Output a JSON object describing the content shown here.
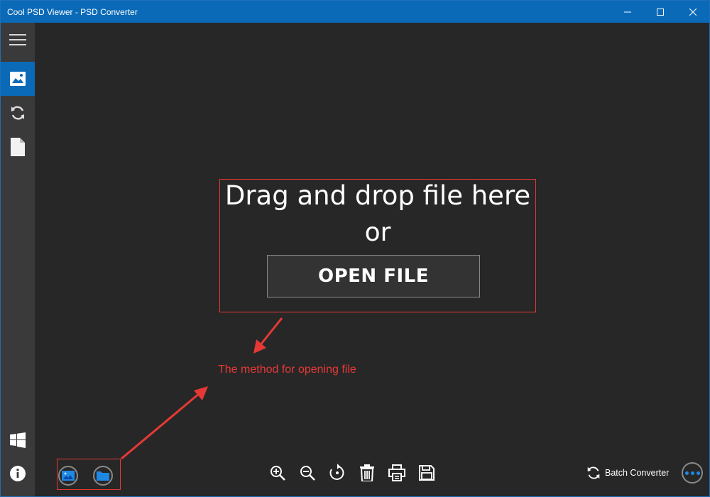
{
  "window": {
    "title": "Cool PSD Viewer - PSD Converter"
  },
  "sidebar": {
    "items": [
      {
        "icon": "hamburger-menu-icon",
        "active": false
      },
      {
        "icon": "image-icon",
        "active": true
      },
      {
        "icon": "convert-sync-icon",
        "active": false
      },
      {
        "icon": "document-icon",
        "active": false
      },
      {
        "icon": "windows-logo-icon",
        "active": false
      },
      {
        "icon": "info-icon",
        "active": false
      }
    ]
  },
  "main": {
    "drop_text": "Drag and drop file here",
    "or_text": "or",
    "open_button": "OPEN FILE"
  },
  "annotation": {
    "text": "The method for opening file",
    "color": "#e53935"
  },
  "bottom_left": [
    {
      "icon": "open-image-icon"
    },
    {
      "icon": "open-folder-icon"
    }
  ],
  "toolbar": [
    {
      "icon": "zoom-in-icon"
    },
    {
      "icon": "zoom-out-icon"
    },
    {
      "icon": "rotate-icon"
    },
    {
      "icon": "delete-icon"
    },
    {
      "icon": "print-icon"
    },
    {
      "icon": "save-icon"
    }
  ],
  "batch_converter": {
    "label": "Batch Converter"
  },
  "colors": {
    "accent": "#0a6ab8",
    "background": "#272727",
    "sidebar": "#3a3a3a"
  }
}
